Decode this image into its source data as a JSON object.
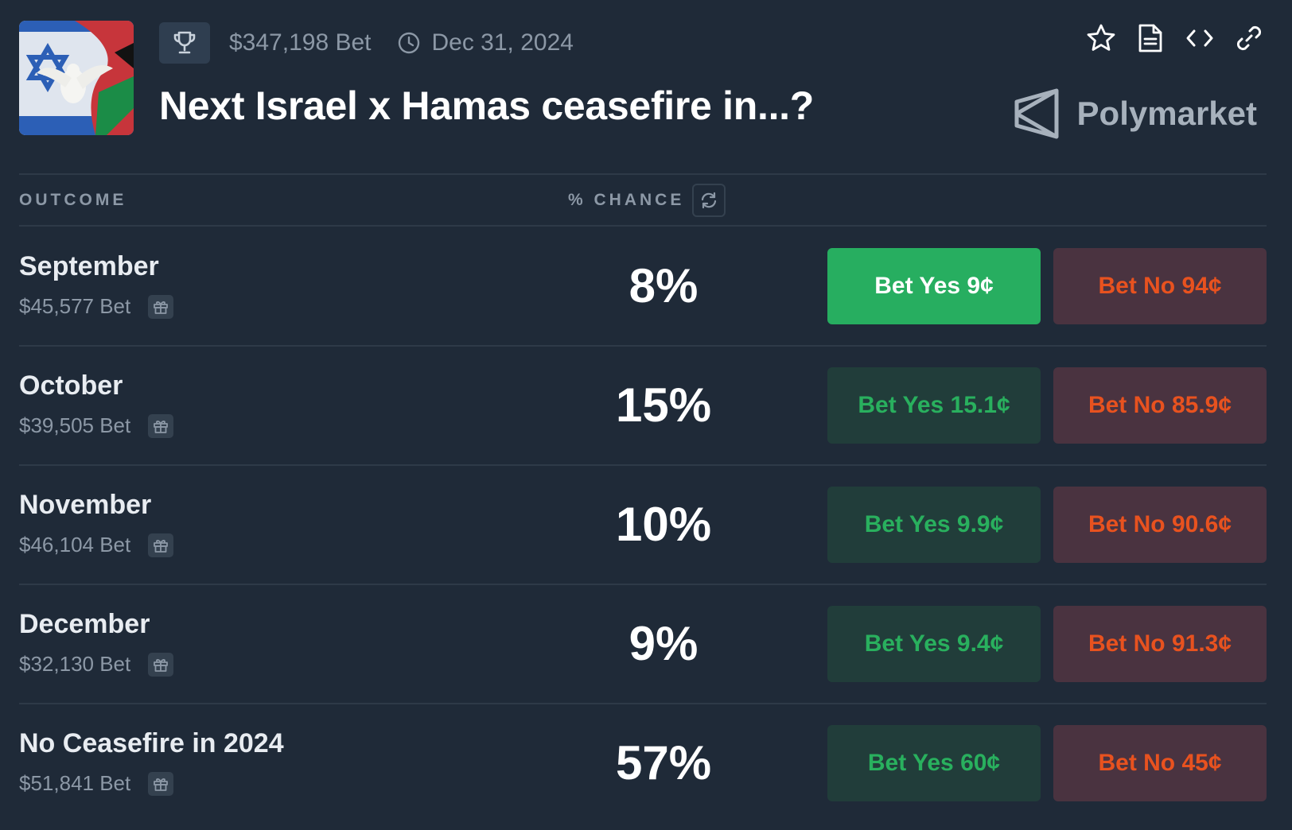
{
  "header": {
    "volume": "$347,198 Bet",
    "end_date": "Dec 31, 2024",
    "title": "Next Israel x Hamas ceasefire in...?",
    "brand": "Polymarket",
    "icons": [
      "trophy-icon",
      "clock-icon",
      "star-icon",
      "document-icon",
      "code-icon",
      "link-icon"
    ]
  },
  "table": {
    "col_outcome": "OUTCOME",
    "col_chance": "% CHANCE",
    "rows": [
      {
        "name": "September",
        "volume": "$45,577 Bet",
        "chance": "8%",
        "yes_label": "Bet Yes 9¢",
        "no_label": "Bet No 94¢"
      },
      {
        "name": "October",
        "volume": "$39,505 Bet",
        "chance": "15%",
        "yes_label": "Bet Yes 15.1¢",
        "no_label": "Bet No 85.9¢"
      },
      {
        "name": "November",
        "volume": "$46,104 Bet",
        "chance": "10%",
        "yes_label": "Bet Yes 9.9¢",
        "no_label": "Bet No 90.6¢"
      },
      {
        "name": "December",
        "volume": "$32,130 Bet",
        "chance": "9%",
        "yes_label": "Bet Yes 9.4¢",
        "no_label": "Bet No 91.3¢"
      },
      {
        "name": "No Ceasefire in 2024",
        "volume": "$51,841 Bet",
        "chance": "57%",
        "yes_label": "Bet Yes 60¢",
        "no_label": "Bet No 45¢"
      }
    ]
  },
  "colors": {
    "background": "#1f2a38",
    "yes_active": "#27ae60",
    "yes_text": "#29b05e",
    "no_text": "#e8521f"
  }
}
